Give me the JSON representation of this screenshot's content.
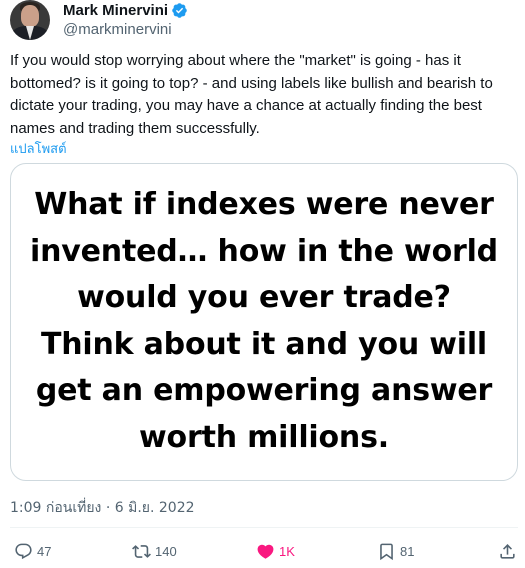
{
  "author": {
    "display_name": "Mark Minervini",
    "handle": "@markminervini",
    "verified": true
  },
  "tweet": {
    "text": "If you would stop worrying about where the \"market\" is going - has it\nbottomed? is it going to top? - and using labels like bullish and bearish to\ndictate your trading, you may have a chance at actually finding the best\nnames and trading them successfully.",
    "translate_label": "แปลโพสต์",
    "timestamp": "1:09 ก่อนเที่ยง · 6 มิ.ย. 2022"
  },
  "media": {
    "lines": [
      "What if indexes were never",
      "invented… how in the world",
      "would you ever trade?",
      "Think about it and you will",
      "get an empowering answer",
      "worth millions."
    ]
  },
  "actions": {
    "reply": {
      "icon": "reply-icon",
      "count": "47"
    },
    "retweet": {
      "icon": "retweet-icon",
      "count": "140"
    },
    "like": {
      "icon": "heart-icon",
      "count": "1K",
      "active": true,
      "color": "#f91880"
    },
    "bookmark": {
      "icon": "bookmark-icon",
      "count": "81"
    },
    "share": {
      "icon": "share-icon"
    }
  },
  "colors": {
    "text_primary": "#0f1419",
    "text_secondary": "#536471",
    "link": "#1d9bf0",
    "verified": "#1d9bf0",
    "like_active": "#f91880",
    "border": "#cfd9de"
  }
}
